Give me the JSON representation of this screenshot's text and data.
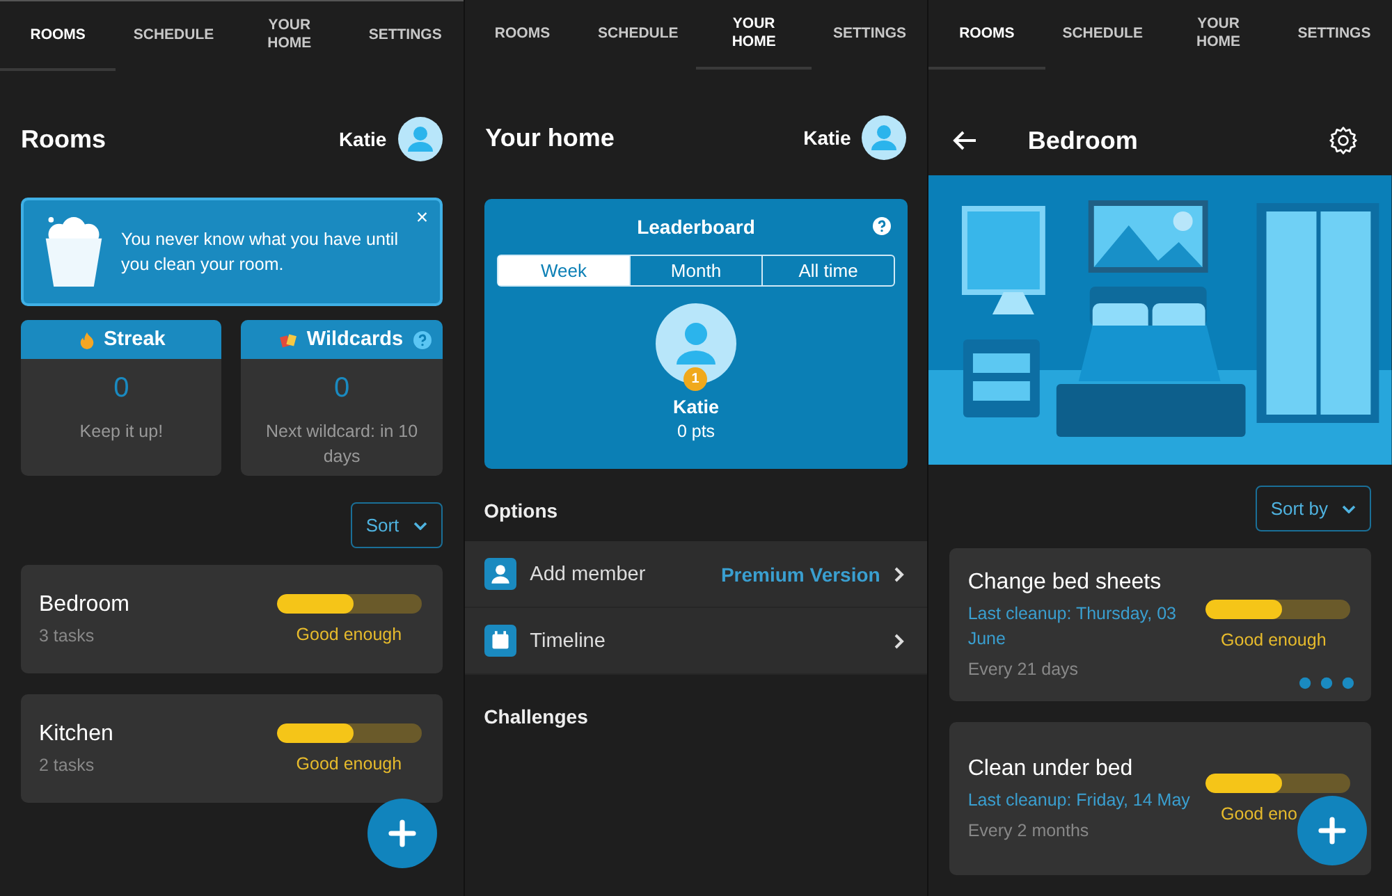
{
  "screens": [
    {
      "kind": "rooms",
      "tabs": [
        {
          "label": "ROOMS",
          "selected": true
        },
        {
          "label": "SCHEDULE",
          "selected": false
        },
        {
          "label": "YOUR HOME",
          "selected": false
        },
        {
          "label": "SETTINGS",
          "selected": false
        }
      ],
      "title": "Rooms",
      "user": "Katie",
      "tip": {
        "text": "You never know what you have until you clean your room.",
        "close": "×"
      },
      "stats": [
        {
          "kind": "streak",
          "title": "Streak",
          "value": "0",
          "note": "Keep it up!",
          "help": false
        },
        {
          "kind": "wildcards",
          "title": "Wildcards",
          "value": "0",
          "note": "Next wildcard: in 10 days",
          "help": true
        }
      ],
      "sort": "Sort",
      "rooms": [
        {
          "name": "Bedroom",
          "tasks": "3 tasks",
          "level": 0.53,
          "status": "Good enough"
        },
        {
          "name": "Kitchen",
          "tasks": "2 tasks",
          "level": 0.53,
          "status": "Good enough"
        }
      ]
    },
    {
      "kind": "home",
      "tabs": [
        {
          "label": "ROOMS",
          "selected": false
        },
        {
          "label": "SCHEDULE",
          "selected": false
        },
        {
          "label": "YOUR HOME",
          "selected": true
        },
        {
          "label": "SETTINGS",
          "selected": false
        }
      ],
      "title": "Your home",
      "user": "Katie",
      "leaderboard": {
        "title": "Leaderboard",
        "periods": [
          {
            "label": "Week",
            "selected": true
          },
          {
            "label": "Month",
            "selected": false
          },
          {
            "label": "All time",
            "selected": false
          }
        ],
        "leader": {
          "rank": "1",
          "name": "Katie",
          "points": "0 pts"
        }
      },
      "options_title": "Options",
      "options": [
        {
          "kind": "member",
          "label": "Add member",
          "extra": "Premium Version"
        },
        {
          "kind": "timeline",
          "label": "Timeline"
        }
      ],
      "challenges_title": "Challenges"
    },
    {
      "kind": "room",
      "tabs": [
        {
          "label": "ROOMS",
          "selected": true
        },
        {
          "label": "SCHEDULE",
          "selected": false
        },
        {
          "label": "YOUR HOME",
          "selected": false
        },
        {
          "label": "SETTINGS",
          "selected": false
        }
      ],
      "title": "Bedroom",
      "sort": "Sort by",
      "tasks": [
        {
          "name": "Change bed sheets",
          "last": "Last cleanup: Thursday, 03 June",
          "interval": "Every 21 days",
          "level": 0.53,
          "status": "Good enough",
          "more": true
        },
        {
          "name": "Clean under bed",
          "last": "Last cleanup: Friday, 14 May",
          "interval": "Every 2 months",
          "level": 0.53,
          "status": "Good eno",
          "more": false
        }
      ]
    }
  ]
}
